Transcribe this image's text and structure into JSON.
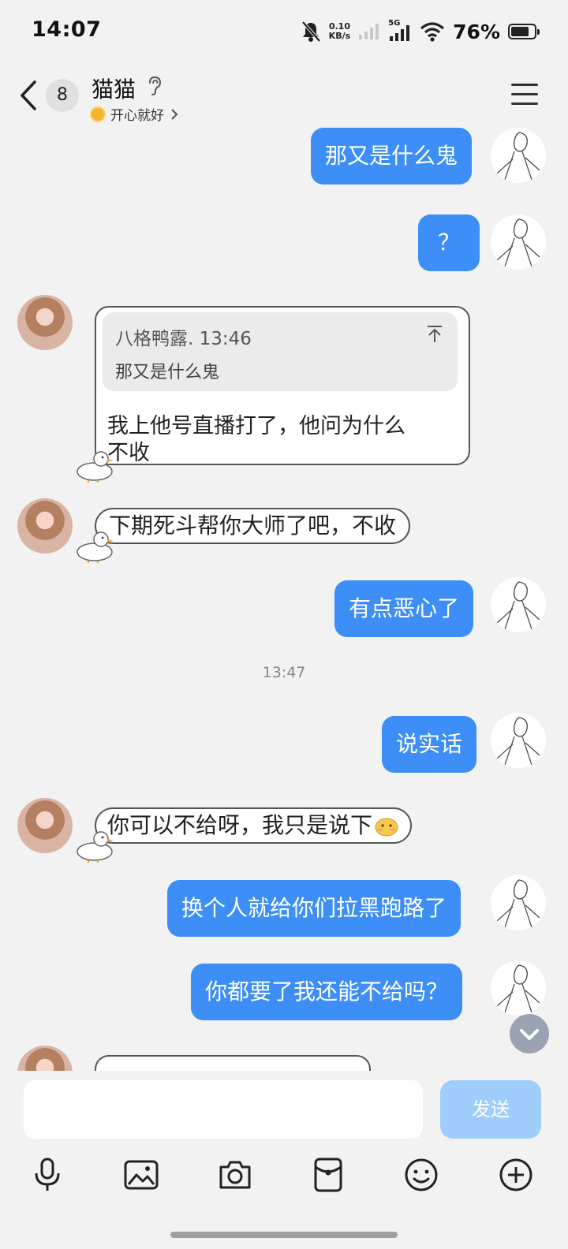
{
  "status_bar": {
    "time": "14:07",
    "net_speed_value": "0.10",
    "net_speed_unit": "KB/s",
    "network": "5G",
    "battery_percent": "76%"
  },
  "header": {
    "unread_count": "8",
    "contact_name": "猫猫",
    "status_text": "开心就好"
  },
  "messages": [
    {
      "from": "me",
      "text": "那又是什么鬼"
    },
    {
      "from": "me",
      "text": "？"
    },
    {
      "from": "her",
      "quote_author": "八格鸭露. 13:46",
      "quote_text": "那又是什么鬼",
      "text_line1": "我上他号直播打了，他问为什么",
      "text_line2": "不收"
    },
    {
      "from": "her",
      "text": "下期死斗帮你大师了吧，不收"
    },
    {
      "from": "me",
      "text": "有点恶心了"
    },
    {
      "type": "timestamp",
      "text": "13:47"
    },
    {
      "from": "me",
      "text": "说实话"
    },
    {
      "from": "her",
      "text": "你可以不给呀，我只是说下"
    },
    {
      "from": "me",
      "text": "换个人就给你们拉黑跑路了"
    },
    {
      "from": "me",
      "text": "你都要了我还能不给吗？"
    }
  ],
  "input": {
    "placeholder": "",
    "send_label": "发送"
  },
  "toolbar": {
    "icons": [
      "microphone-icon",
      "image-icon",
      "camera-icon",
      "red-packet-icon",
      "emoji-icon",
      "plus-icon"
    ]
  },
  "colors": {
    "my_bubble": "#3d8ef7",
    "send_button": "#9fcdfc",
    "background": "#f2f2f2"
  }
}
